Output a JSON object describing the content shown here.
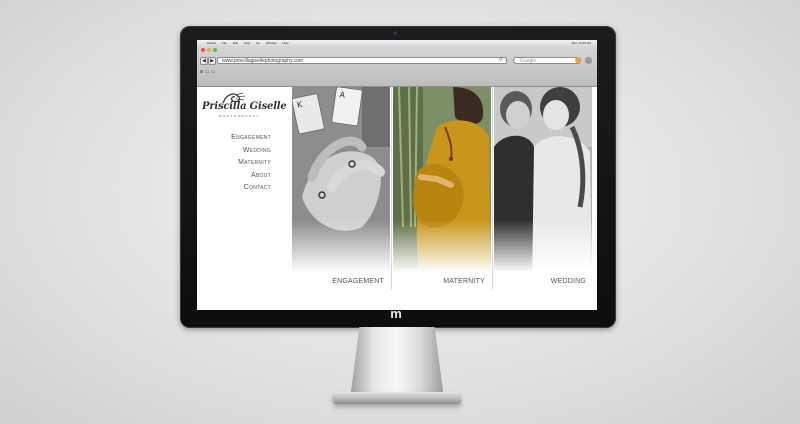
{
  "browser": {
    "menubar": {
      "app": "Firefox",
      "items": [
        "File",
        "Edit",
        "View",
        "Go",
        "Window",
        "Help"
      ],
      "clock": "Mon 10:36 AM"
    },
    "nav": {
      "back": "◀",
      "forward": "▶"
    },
    "url": "www.priscillagisellephotography.com",
    "search_placeholder": "Google",
    "bookmarks": "⊞ ☐ ☐"
  },
  "site": {
    "brand": {
      "name": "Priscilla Giselle",
      "sub": "PHOTOGRAPHY"
    },
    "nav": [
      "Engagement",
      "Wedding",
      "Maternity",
      "About",
      "Contact"
    ],
    "panels": [
      {
        "label": "ENGAGEMENT"
      },
      {
        "label": "MATERNITY"
      },
      {
        "label": "WEDDING"
      }
    ]
  },
  "monitor": {
    "badge": "m"
  },
  "colors": {
    "dress": "#c8961a",
    "accent_bg": "#ffffff"
  }
}
